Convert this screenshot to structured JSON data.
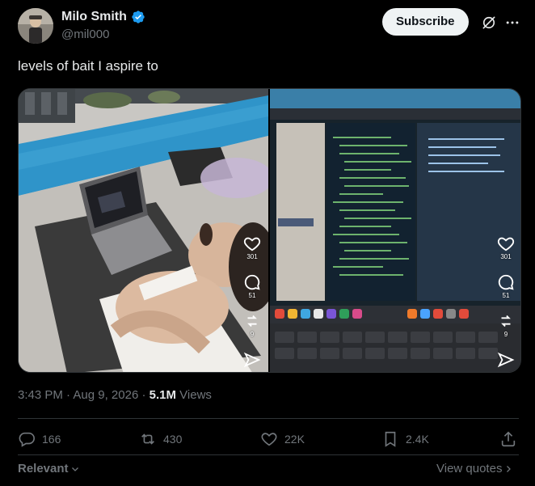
{
  "author": {
    "display_name": "Milo Smith",
    "handle": "@mil000",
    "verified_icon": "verified-badge-icon",
    "verified_color": "#1d9bf0"
  },
  "header": {
    "subscribe_label": "Subscribe"
  },
  "tweet": {
    "text": "levels of bait I aspire to"
  },
  "media": {
    "left": {
      "like_count": "301",
      "comment_count": "51",
      "share_count": "9"
    },
    "right": {
      "like_count": "301",
      "comment_count": "51",
      "share_count": "9"
    }
  },
  "meta": {
    "time": "3:43 PM",
    "sep1": " · ",
    "date": "Aug 9, 2026",
    "sep2": " · ",
    "views_count": "5.1M",
    "views_label": " Views"
  },
  "actions": {
    "replies": "166",
    "reposts": "430",
    "likes": "22K",
    "bookmarks": "2.4K"
  },
  "footer": {
    "relevant_label": "Relevant",
    "view_quotes_label": "View quotes"
  },
  "colors": {
    "background": "#000000",
    "text": "#e7e9ea",
    "muted": "#71767b",
    "border": "#2f3336"
  }
}
